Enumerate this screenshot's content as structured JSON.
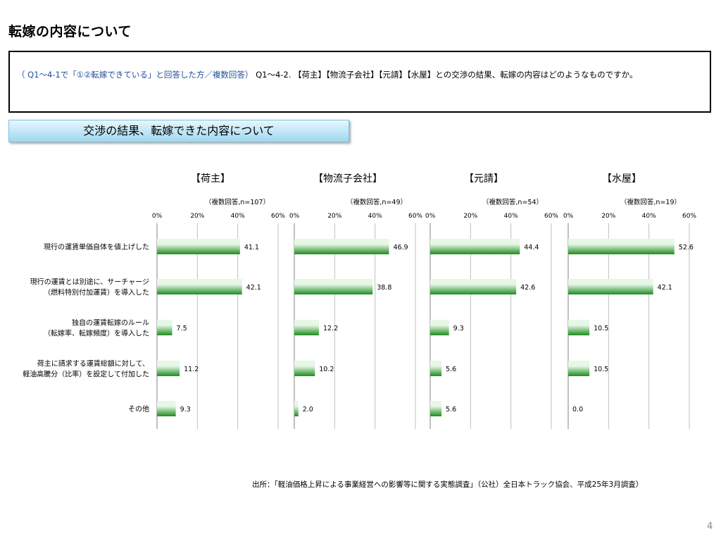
{
  "page": {
    "title": "転嫁の内容について",
    "question_prefix": "（ Q1～4-1で「①②転嫁できている」と回答した方／複数回答）",
    "question_body": "Q1～4-2. 【荷主】【物流子会社】【元請】【水屋】との交渉の結果、転嫁の内容はどのようなものですか。",
    "subtitle": "交渉の結果、転嫁できた内容について",
    "source": "出所：「軽油価格上昇による事業経営への影響等に関する実態調査」（公社）全日本トラック協会、平成25年3月調査）",
    "page_number": "4"
  },
  "colors": {
    "bar_light": "#e6f7e6",
    "bar_dark": "#1e8c1e",
    "grid": "#bfbfbf",
    "axis": "#808080",
    "subtitle_bg": "#bfe6f7"
  },
  "chart_data": {
    "type": "bar",
    "orientation": "horizontal",
    "categories": [
      [
        "現行の運賃単価自体を値上げした"
      ],
      [
        "現行の運賃とは別途に、サーチャージ",
        "（燃料特別付加運賃）を導入した"
      ],
      [
        "独自の運賃転嫁のルール",
        "（転嫁率、転嫁頻度）を導入した"
      ],
      [
        "荷主に請求する運賃総額に対して、",
        "軽油高騰分（比率）を設定して付加した"
      ],
      [
        "その他"
      ]
    ],
    "xlim": [
      0,
      60
    ],
    "ticks": [
      0,
      20,
      40,
      60
    ],
    "tick_labels": [
      "0%",
      "20%",
      "40%",
      "60%"
    ],
    "grid": true,
    "panels": [
      {
        "title": "【荷主】",
        "note": "（複数回答,n=107）",
        "values": [
          41.1,
          42.1,
          7.5,
          11.2,
          9.3
        ],
        "labels": [
          "41.1",
          "42.1",
          "7.5",
          "11.2",
          "9.3"
        ]
      },
      {
        "title": "【物流子会社】",
        "note": "（複数回答,n=49）",
        "values": [
          46.9,
          38.8,
          12.2,
          10.2,
          2.0
        ],
        "labels": [
          "46.9",
          "38.8",
          "12.2",
          "10.2",
          "2.0"
        ]
      },
      {
        "title": "【元請】",
        "note": "（複数回答,n=54）",
        "values": [
          44.4,
          42.6,
          9.3,
          5.6,
          5.6
        ],
        "labels": [
          "44.4",
          "42.6",
          "9.3",
          "5.6",
          "5.6"
        ]
      },
      {
        "title": "【水屋】",
        "note": "（複数回答,n=19）",
        "values": [
          52.6,
          42.1,
          10.5,
          10.5,
          0.0
        ],
        "labels": [
          "52.6",
          "42.1",
          "10.5",
          "10.5",
          "0.0"
        ]
      }
    ]
  }
}
